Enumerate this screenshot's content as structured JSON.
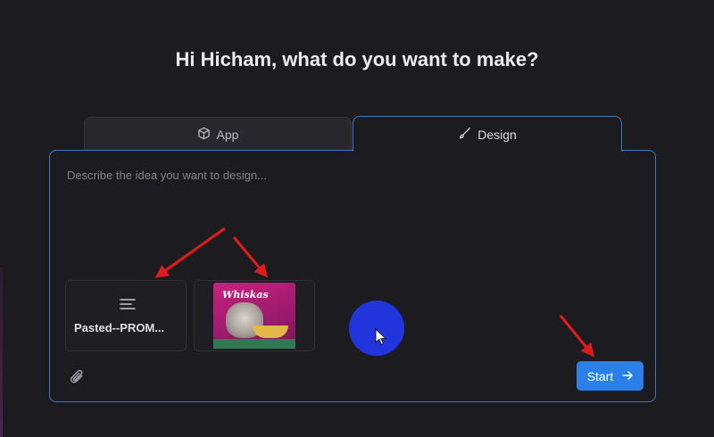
{
  "heading": "Hi Hicham, what do you want to make?",
  "tabs": [
    {
      "label": "App",
      "icon": "cube-icon",
      "active": false
    },
    {
      "label": "Design",
      "icon": "brush-icon",
      "active": true
    }
  ],
  "prompt": {
    "placeholder": "Describe the idea you want to design...",
    "value": ""
  },
  "attachments": [
    {
      "type": "text",
      "name": "Pasted--PROM...",
      "icon": "text-lines-icon"
    },
    {
      "type": "image",
      "logo_text": "Whiskas"
    }
  ],
  "attach_icon": "paperclip-icon",
  "start_button": {
    "label": "Start",
    "icon": "arrow-right-icon"
  },
  "colors": {
    "background": "#1c1c20",
    "accent_border": "#3a78c4",
    "button": "#2a80e8",
    "annotation_arrow": "#e01b1b",
    "cursor_highlight": "#2234dc"
  }
}
